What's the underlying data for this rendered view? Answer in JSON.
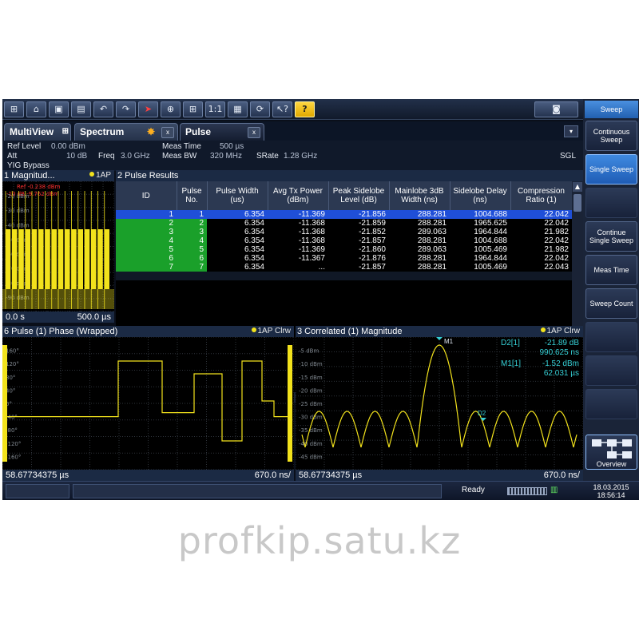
{
  "toolbar": {
    "buttons": [
      "windows-icon",
      "open-icon",
      "save-icon",
      "print-icon",
      "undo-icon",
      "redo-icon",
      "pointer-icon",
      "zoom-icon",
      "zoom-multi-icon",
      "zoom-1to1-icon",
      "display-icon",
      "sequencer-icon",
      "context-help-icon",
      "help-icon"
    ],
    "camera_icon": "camera-icon"
  },
  "softkeys": {
    "title": "Sweep",
    "items": [
      {
        "label": "Continuous Sweep",
        "active": false
      },
      {
        "label": "Single Sweep",
        "active": true
      },
      {
        "label": "",
        "active": false
      },
      {
        "label": "Continue Single Sweep",
        "active": false
      },
      {
        "label": "Meas Time",
        "active": false
      },
      {
        "label": "Sweep Count",
        "active": false
      },
      {
        "label": "",
        "active": false
      },
      {
        "label": "",
        "active": false
      }
    ],
    "overview_label": "Overview"
  },
  "tabs": {
    "multiview": "MultiView",
    "spectrum": "Spectrum",
    "pulse": "Pulse",
    "close": "x",
    "dropdown": "▾"
  },
  "settings": {
    "ref_level_label": "Ref Level",
    "ref_level_value": "0.00 dBm",
    "att_label": "Att",
    "att_value": "10 dB",
    "freq_label": "Freq",
    "freq_value": "3.0 GHz",
    "yig": "YIG Bypass",
    "meas_time_label": "Meas Time",
    "meas_time_value": "500 µs",
    "meas_bw_label": "Meas BW",
    "meas_bw_value": "320 MHz",
    "srate_label": "SRate",
    "srate_value": "1.28 GHz",
    "mode": "SGL"
  },
  "pane1": {
    "title": "1 Magnitud...",
    "trace": "1AP",
    "ref": "Ref -0.238 dBm",
    "offset": "-10 dB -9.762 dBm",
    "yticks": [
      "-20 dBm",
      "-30 dBm",
      "-40 dBm",
      "-50 dBm",
      "-60 dBm",
      "-70 dBm",
      "-80 dBm",
      "-90 dBm"
    ],
    "x_start": "0.0 s",
    "x_end": "500.0 µs"
  },
  "pane2": {
    "title": "2 Pulse Results",
    "headers": [
      "ID",
      "Pulse No.",
      "Pulse Width (us)",
      "Avg Tx Power (dBm)",
      "Peak Sidelobe Level (dB)",
      "Mainlobe 3dB Width (ns)",
      "Sidelobe Delay (ns)",
      "Compression Ratio (1)"
    ],
    "rows": [
      [
        "1",
        "1",
        "6.354",
        "-11.369",
        "-21.856",
        "288.281",
        "1004.688",
        "22.042"
      ],
      [
        "2",
        "2",
        "6.354",
        "-11.368",
        "-21.859",
        "288.281",
        "1965.625",
        "22.042"
      ],
      [
        "3",
        "3",
        "6.354",
        "-11.368",
        "-21.852",
        "289.063",
        "1964.844",
        "21.982"
      ],
      [
        "4",
        "4",
        "6.354",
        "-11.368",
        "-21.857",
        "288.281",
        "1004.688",
        "22.042"
      ],
      [
        "5",
        "5",
        "6.354",
        "-11.369",
        "-21.860",
        "289.063",
        "1005.469",
        "21.982"
      ],
      [
        "6",
        "6",
        "6.354",
        "-11.367",
        "-21.876",
        "288.281",
        "1964.844",
        "22.042"
      ],
      [
        "7",
        "7",
        "6.354",
        "...",
        "-21.857",
        "288.281",
        "1005.469",
        "22.043"
      ]
    ],
    "selected_row": 0,
    "highlight_color": "#1aa02a",
    "select_color": "#1f4fd8"
  },
  "pane6": {
    "title": "6 Pulse (1) Phase (Wrapped)",
    "trace": "1AP Clrw",
    "yticks": [
      "160°",
      "120°",
      "80°",
      "40°",
      "0°",
      "-40°",
      "-80°",
      "-120°",
      "-160°"
    ],
    "x_start": "58.67734375 µs",
    "x_end": "670.0 ns/"
  },
  "pane3": {
    "title": "3 Correlated (1) Magnitude",
    "trace": "1AP Clrw",
    "yticks": [
      "-5 dBm",
      "-10 dBm",
      "-15 dBm",
      "-20 dBm",
      "-25 dBm",
      "-30 dBm",
      "-35 dBm",
      "-40 dBm",
      "-45 dBm"
    ],
    "d2_label": "D2[1]",
    "d2_level": "-21.89 dB",
    "d2_delay": "990.625 ns",
    "m1_label": "M1[1]",
    "m1_level": "-1.52 dBm",
    "m1_time": "62.031 µs",
    "marker_m1": "M1",
    "marker_d2": "D2",
    "x_start": "58.67734375 µs",
    "x_end": "670.0 ns/"
  },
  "status": {
    "ready": "Ready",
    "date": "18.03.2015",
    "time": "18:56:14"
  },
  "watermark": "profkip.satu.kz",
  "colors": {
    "trace": "#f2e21c",
    "marker": "#36d0d6",
    "accent": "#2f7ad8"
  }
}
